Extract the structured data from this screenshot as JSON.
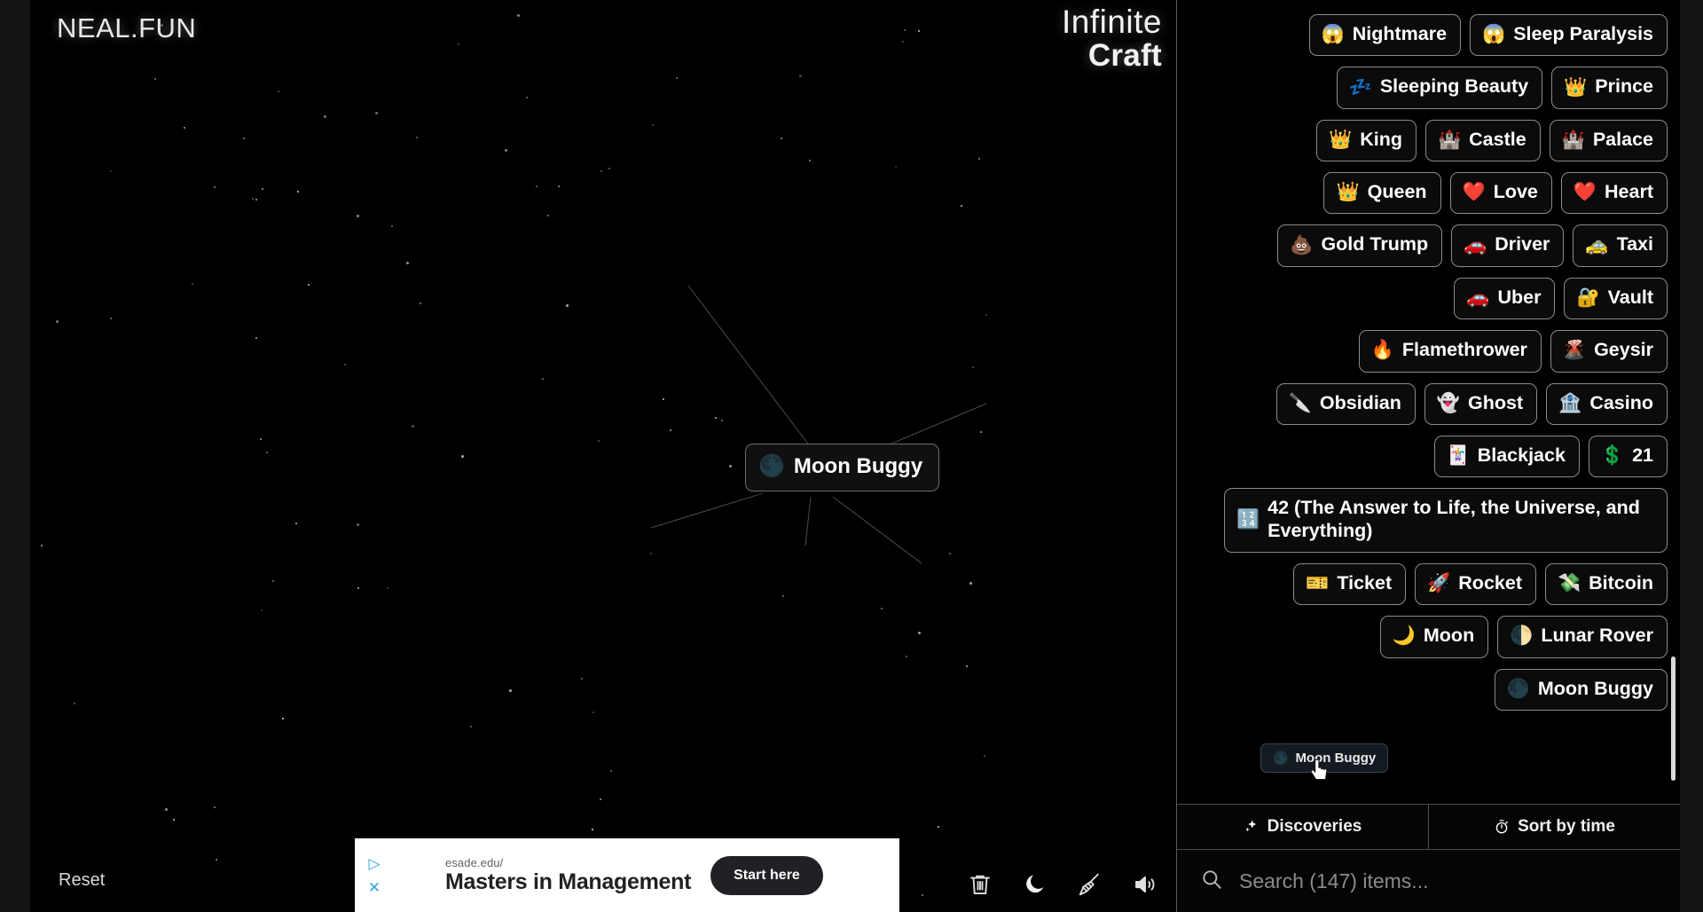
{
  "site": {
    "logo": "NEAL.FUN",
    "brand_line1": "Infinite",
    "brand_line2": "Craft"
  },
  "canvas": {
    "node": {
      "emoji": "🌑",
      "label": "Moon Buggy"
    },
    "reset_label": "Reset"
  },
  "ad": {
    "url": "esade.edu/",
    "title": "Masters in Management",
    "cta": "Start here",
    "play_glyph": "▷",
    "close_glyph": "✕"
  },
  "tools": [
    {
      "name": "trash-icon",
      "title": "Clear"
    },
    {
      "name": "moon-icon",
      "title": "Dark mode"
    },
    {
      "name": "broom-icon",
      "title": "Tidy"
    },
    {
      "name": "sound-icon",
      "title": "Sound"
    }
  ],
  "sidebar": {
    "rows": [
      {
        "cut": true,
        "items": [
          {
            "emoji": "",
            "label": ""
          },
          {
            "emoji": "",
            "label": ""
          }
        ]
      },
      {
        "items": [
          {
            "emoji": "😱",
            "label": "Nightmare"
          },
          {
            "emoji": "😱",
            "label": "Sleep Paralysis"
          }
        ]
      },
      {
        "items": [
          {
            "emoji": "💤",
            "label": "Sleeping Beauty"
          },
          {
            "emoji": "👑",
            "label": "Prince"
          }
        ]
      },
      {
        "items": [
          {
            "emoji": "👑",
            "label": "King"
          },
          {
            "emoji": "🏰",
            "label": "Castle"
          },
          {
            "emoji": "🏰",
            "label": "Palace"
          }
        ]
      },
      {
        "items": [
          {
            "emoji": "👑",
            "label": "Queen"
          },
          {
            "emoji": "❤️",
            "label": "Love"
          },
          {
            "emoji": "❤️",
            "label": "Heart"
          }
        ]
      },
      {
        "items": [
          {
            "emoji": "💩",
            "label": "Gold Trump"
          },
          {
            "emoji": "🚗",
            "label": "Driver"
          },
          {
            "emoji": "🚕",
            "label": "Taxi"
          }
        ]
      },
      {
        "items": [
          {
            "emoji": "🚗",
            "label": "Uber"
          },
          {
            "emoji": "🔐",
            "label": "Vault"
          }
        ]
      },
      {
        "items": [
          {
            "emoji": "🔥",
            "label": "Flamethrower"
          },
          {
            "emoji": "🌋",
            "label": "Geysir"
          }
        ]
      },
      {
        "items": [
          {
            "emoji": "🔪",
            "label": "Obsidian"
          },
          {
            "emoji": "👻",
            "label": "Ghost"
          },
          {
            "emoji": "🏦",
            "label": "Casino"
          }
        ]
      },
      {
        "items": [
          {
            "emoji": "🃏",
            "label": "Blackjack"
          },
          {
            "emoji": "💲",
            "label": "21"
          }
        ]
      },
      {
        "items": [
          {
            "emoji": "🔢",
            "label": "42 (The Answer to Life, the Universe, and Everything)",
            "wrap": true
          }
        ]
      },
      {
        "items": [
          {
            "emoji": "🎫",
            "label": "Ticket"
          },
          {
            "emoji": "🚀",
            "label": "Rocket"
          },
          {
            "emoji": "💸",
            "label": "Bitcoin"
          }
        ]
      },
      {
        "items": [
          {
            "emoji": "🌙",
            "label": "Moon"
          },
          {
            "emoji": "🌓",
            "label": "Lunar Rover"
          }
        ]
      },
      {
        "items": [
          {
            "emoji": "🌑",
            "label": "Moon Buggy"
          }
        ]
      }
    ],
    "drag_ghost": {
      "emoji": "🌑",
      "label": "Moon Buggy"
    },
    "tabs": [
      {
        "icon": "sparkles-icon",
        "label": "Discoveries"
      },
      {
        "icon": "stopwatch-icon",
        "label": "Sort by time"
      }
    ],
    "search": {
      "placeholder": "Search (147) items...",
      "value": "",
      "count": 147
    }
  },
  "colors": {
    "background": "#000000",
    "chip_border": "#8b8b8b",
    "chip_bg": "#0b0b0b",
    "text": "#ffffff",
    "accent_ad": "#2fa8dd",
    "scrollbar": "#d9d9d9"
  }
}
